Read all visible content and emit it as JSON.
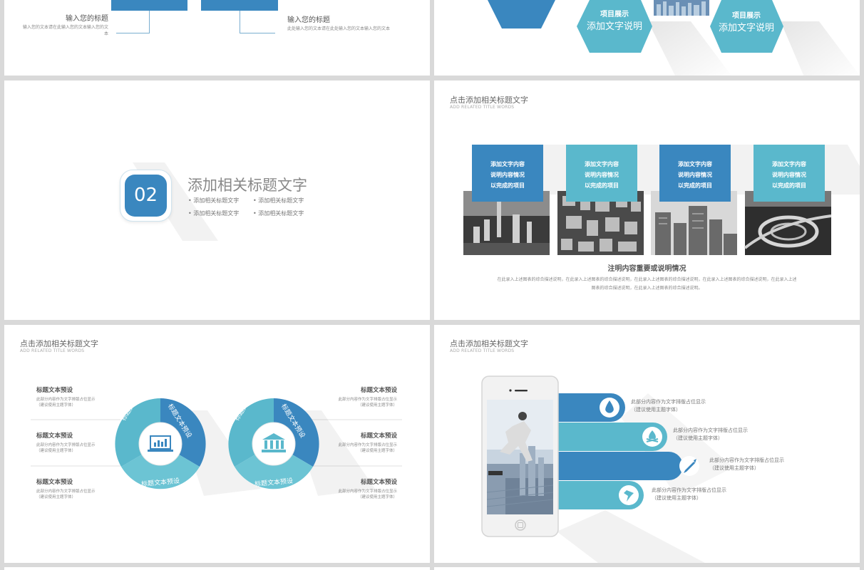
{
  "slide1": {
    "left_title": "输入您的标题",
    "left_text": "输入您的文本请在此输入您的文本输入您的文本",
    "right_title": "输入您的标题",
    "right_text": "此处输入您的文本请在此处输入您的文本输入您的文本"
  },
  "slide2": {
    "hex1_title": "项目展示",
    "hex1_sub": "添加文字说明",
    "hex2_title": "项目展示",
    "hex2_sub": "添加文字说明"
  },
  "slide3": {
    "number": "02",
    "title": "添加相关标题文字",
    "bullets": [
      "添加相关标题文字",
      "添加相关标题文字",
      "添加相关标题文字",
      "添加相关标题文字"
    ]
  },
  "slide4": {
    "header": "点击添加相关标题文字",
    "header_sub": "ADD RELATED TITLE WORDS",
    "cards": [
      {
        "lines": [
          "添加文字内容",
          "说明内容情况",
          "以完成的项目"
        ]
      },
      {
        "lines": [
          "添加文字内容",
          "说明内容情况",
          "以完成的项目"
        ]
      },
      {
        "lines": [
          "添加文字内容",
          "说明内容情况",
          "以完成的项目"
        ]
      },
      {
        "lines": [
          "添加文字内容",
          "说明内容情况",
          "以完成的项目"
        ]
      }
    ],
    "caption_title": "注明内容重要或说明情况",
    "caption_text_1": "在此录入上述图表的综合描述说明，在此录入上述图表的综合描述说明，在此录入上述图表的综合描述说明，在此录入上述图表的综合描述说明，在此录入上述",
    "caption_text_2": "图表的综合描述说明，在此录入上述图表的综合描述说明。"
  },
  "slide5": {
    "header": "点击添加相关标题文字",
    "header_sub": "ADD RELATED TITLE WORDS",
    "items_left": [
      {
        "title": "标题文本预设",
        "text1": "此部分内容作为文字排版占位显示",
        "text2": "（建议使用主题字体）"
      },
      {
        "title": "标题文本预设",
        "text1": "此部分内容作为文字排版占位显示",
        "text2": "（建议使用主题字体）"
      },
      {
        "title": "标题文本预设",
        "text1": "此部分内容作为文字排版占位显示",
        "text2": "（建议使用主题字体）"
      }
    ],
    "items_right": [
      {
        "title": "标题文本预设",
        "text1": "此部分内容作为文字排版占位显示",
        "text2": "（建议使用主题字体）"
      },
      {
        "title": "标题文本预设",
        "text1": "此部分内容作为文字排版占位显示",
        "text2": "（建议使用主题字体）"
      },
      {
        "title": "标题文本预设",
        "text1": "此部分内容作为文字排版占位显示",
        "text2": "（建议使用主题字体）"
      }
    ],
    "ring_label": "标题文本预设"
  },
  "slide6": {
    "header": "点击添加相关标题文字",
    "header_sub": "ADD RELATED TITLE WORDS",
    "bars": [
      {
        "text1": "此部分内容作为文字排版占位显示",
        "text2": "（建议使用主题字体）",
        "icon": "water-drop-icon"
      },
      {
        "text1": "此部分内容作为文字排版占位显示",
        "text2": "（建议使用主题字体）",
        "icon": "campfire-icon"
      },
      {
        "text1": "此部分内容作为文字排版占位显示",
        "text2": "（建议使用主题字体）",
        "icon": "rocket-icon"
      },
      {
        "text1": "此部分内容作为文字排版占位显示",
        "text2": "（建议使用主题字体）",
        "icon": "pin-icon"
      }
    ]
  },
  "colors": {
    "blue": "#3a87bf",
    "teal": "#5ab8cc",
    "teal_light": "#6cc4d4"
  }
}
